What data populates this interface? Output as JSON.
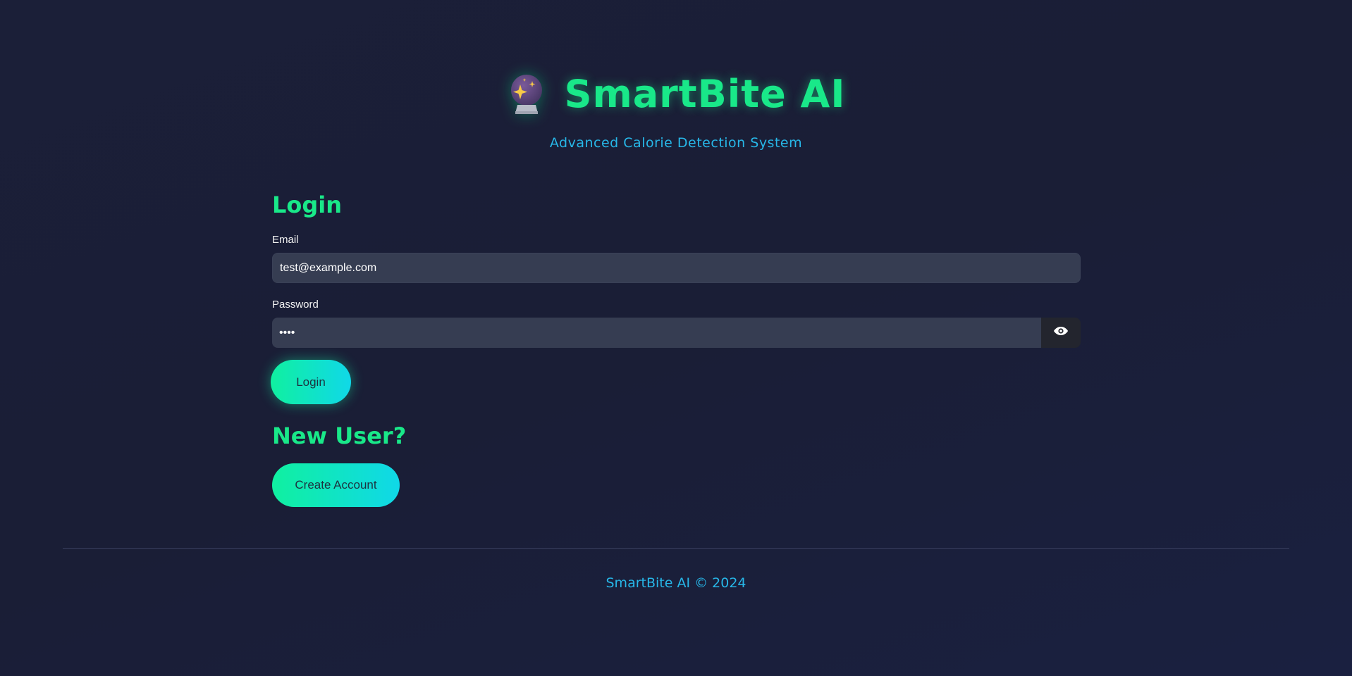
{
  "header": {
    "logo_icon": "crystal-ball-icon",
    "title": "SmartBite AI",
    "subtitle": "Advanced Calorie Detection System"
  },
  "login": {
    "heading": "Login",
    "email_label": "Email",
    "email_value": "test@example.com",
    "password_label": "Password",
    "password_value": "••••",
    "toggle_icon": "eye-icon",
    "submit_label": "Login"
  },
  "signup": {
    "heading": "New User?",
    "button_label": "Create Account"
  },
  "footer": {
    "text": "SmartBite AI © 2024"
  },
  "colors": {
    "accent_green": "#19e889",
    "accent_blue": "#27b7e8",
    "background": "#1b1f38",
    "input_bg": "#363d52"
  }
}
